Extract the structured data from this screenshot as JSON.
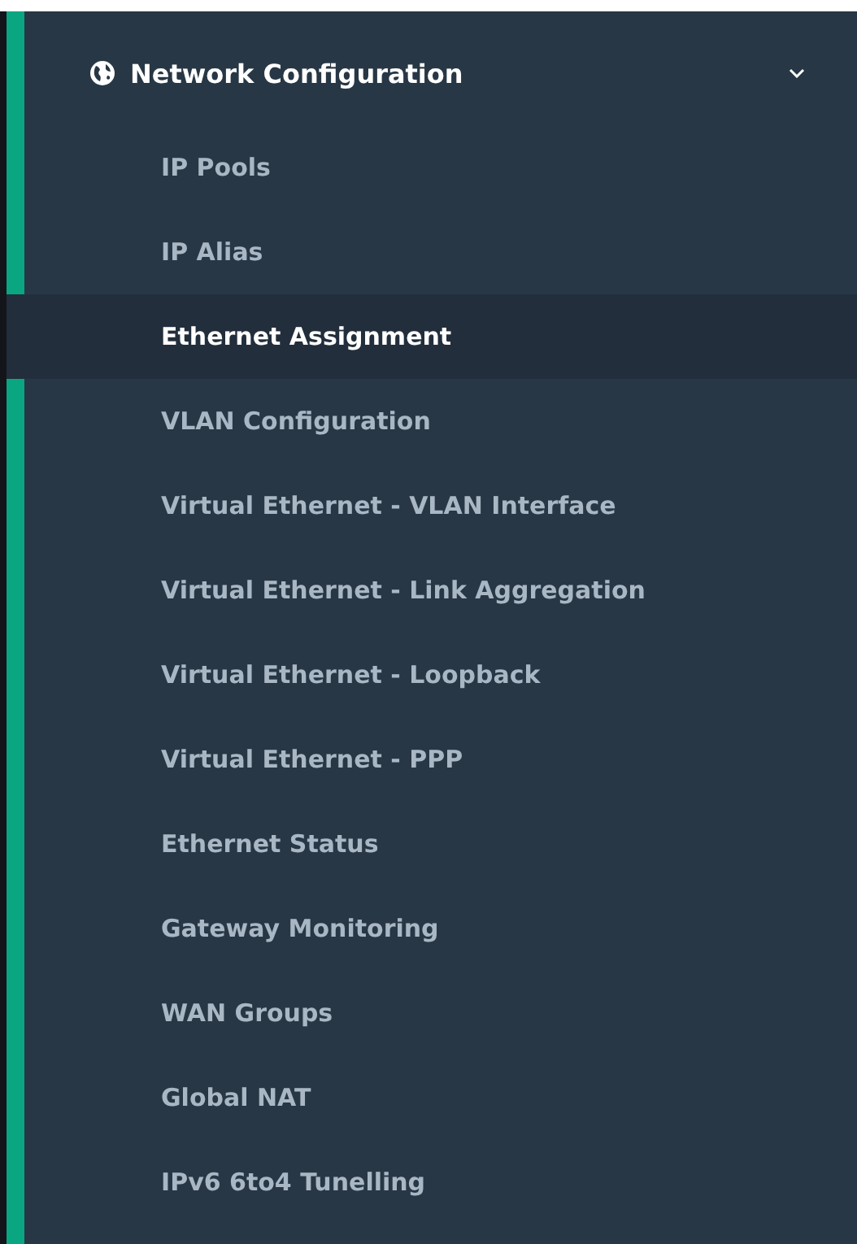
{
  "menu": {
    "title": "Network Configuration",
    "expanded": true,
    "items": [
      {
        "label": "IP Pools",
        "selected": false
      },
      {
        "label": "IP Alias",
        "selected": false
      },
      {
        "label": "Ethernet Assignment",
        "selected": true
      },
      {
        "label": "VLAN Configuration",
        "selected": false
      },
      {
        "label": "Virtual Ethernet - VLAN Interface",
        "selected": false
      },
      {
        "label": "Virtual Ethernet - Link Aggregation",
        "selected": false
      },
      {
        "label": "Virtual Ethernet - Loopback",
        "selected": false
      },
      {
        "label": "Virtual Ethernet - PPP",
        "selected": false
      },
      {
        "label": "Ethernet Status",
        "selected": false
      },
      {
        "label": "Gateway Monitoring",
        "selected": false
      },
      {
        "label": "WAN Groups",
        "selected": false
      },
      {
        "label": "Global NAT",
        "selected": false
      },
      {
        "label": "IPv6 6to4 Tunelling",
        "selected": false
      }
    ]
  }
}
